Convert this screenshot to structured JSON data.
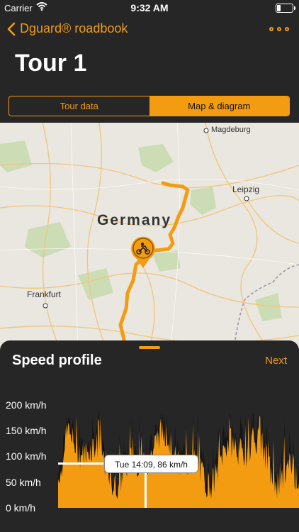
{
  "status_bar": {
    "carrier": "Carrier",
    "time": "9:32 AM",
    "battery_level": 0.2
  },
  "nav": {
    "back_label": "Dguard® roadbook",
    "more_icon": "more-icon"
  },
  "page": {
    "title": "Tour 1"
  },
  "tabs": [
    {
      "label": "Tour data",
      "selected": false
    },
    {
      "label": "Map & diagram",
      "selected": true
    }
  ],
  "map": {
    "country_label": "Germany",
    "cities": [
      "Magdeburg",
      "Leipzig",
      "Frankfurt"
    ],
    "route_color": "#f39c12",
    "marker_icon": "motorcycle-icon"
  },
  "speed_profile": {
    "title": "Speed profile",
    "next_label": "Next",
    "y_axis_labels": [
      "200 km/h",
      "150 km/h",
      "100 km/h",
      "50 km/h",
      "0 km/h"
    ],
    "tooltip": "Tue 14:09, 86 km/h",
    "accent_color": "#f39c12"
  }
}
